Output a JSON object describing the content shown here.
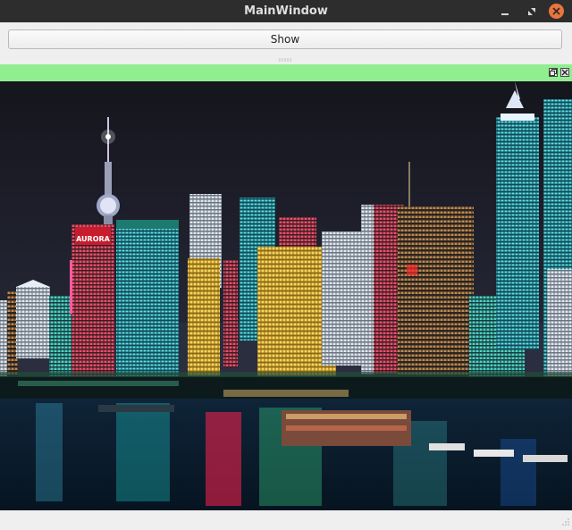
{
  "window": {
    "title": "MainWindow"
  },
  "titlebar_icons": {
    "minimize": "minimize-icon",
    "maximize": "maximize-icon",
    "close": "close-icon",
    "close_color": "#e9763f"
  },
  "toolbar": {
    "show_label": "Show"
  },
  "dock": {
    "header_color": "#90ee90",
    "float_icon": "float-icon",
    "close_icon": "close-icon"
  },
  "image": {
    "subject": "night-city-skyline-photo"
  }
}
